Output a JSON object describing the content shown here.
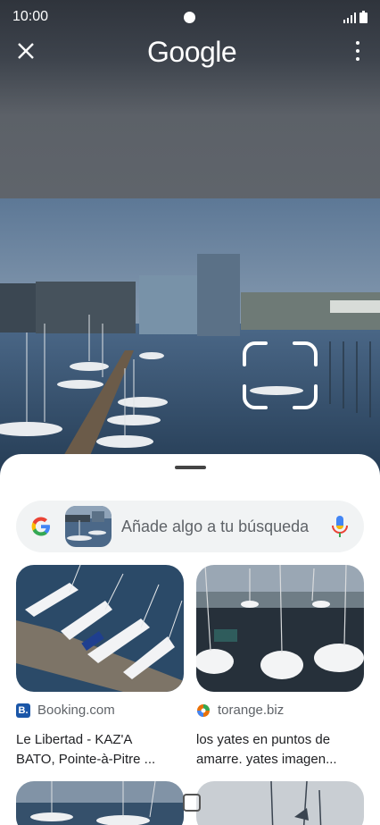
{
  "status": {
    "time": "10:00"
  },
  "header": {
    "logo": "Google"
  },
  "search": {
    "placeholder": "Añade algo a tu búsqueda"
  },
  "results": [
    {
      "source": "Booking.com",
      "title_line1": "Le Libertad - KAZ'A",
      "title_line2": "BATO, Pointe-à-Pitre ...",
      "favicon_color": "#1a56a8"
    },
    {
      "source": "torange.biz",
      "title_line1": "los yates en puntos de",
      "title_line2": "amarre. yates imagen...",
      "favicon_color": "#e8710a"
    }
  ]
}
